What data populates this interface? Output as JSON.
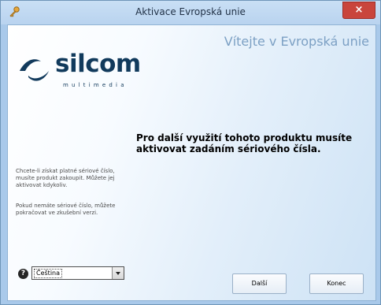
{
  "window": {
    "title": "Aktivace Evropská unie",
    "close_label": "×"
  },
  "header": {
    "welcome": "Vítejte v Evropská unie"
  },
  "logo": {
    "word": "silcom",
    "sub": "multimedia"
  },
  "main": {
    "message": "Pro další využití tohoto produktu musíte aktivovat zadáním sériového čísla."
  },
  "sidebar": {
    "paragraph1": "Chcete-li získat platné sériové číslo, musíte produkt zakoupit. Můžete jej aktivovat kdykoliv.",
    "paragraph2": "Pokud nemáte sériové číslo, můžete pokračovat ve zkušební verzi."
  },
  "footer": {
    "help_label": "?",
    "language": {
      "selected": "Čeština"
    },
    "next_label": "Další",
    "end_label": "Konec"
  },
  "colors": {
    "accent": "#113a5c",
    "close": "#c9453c",
    "welcome": "#7ca0c4"
  },
  "icons": {
    "title": "key-icon",
    "logo": "silcom-swoosh-icon",
    "help": "help-icon",
    "dropdown": "chevron-down-icon"
  }
}
